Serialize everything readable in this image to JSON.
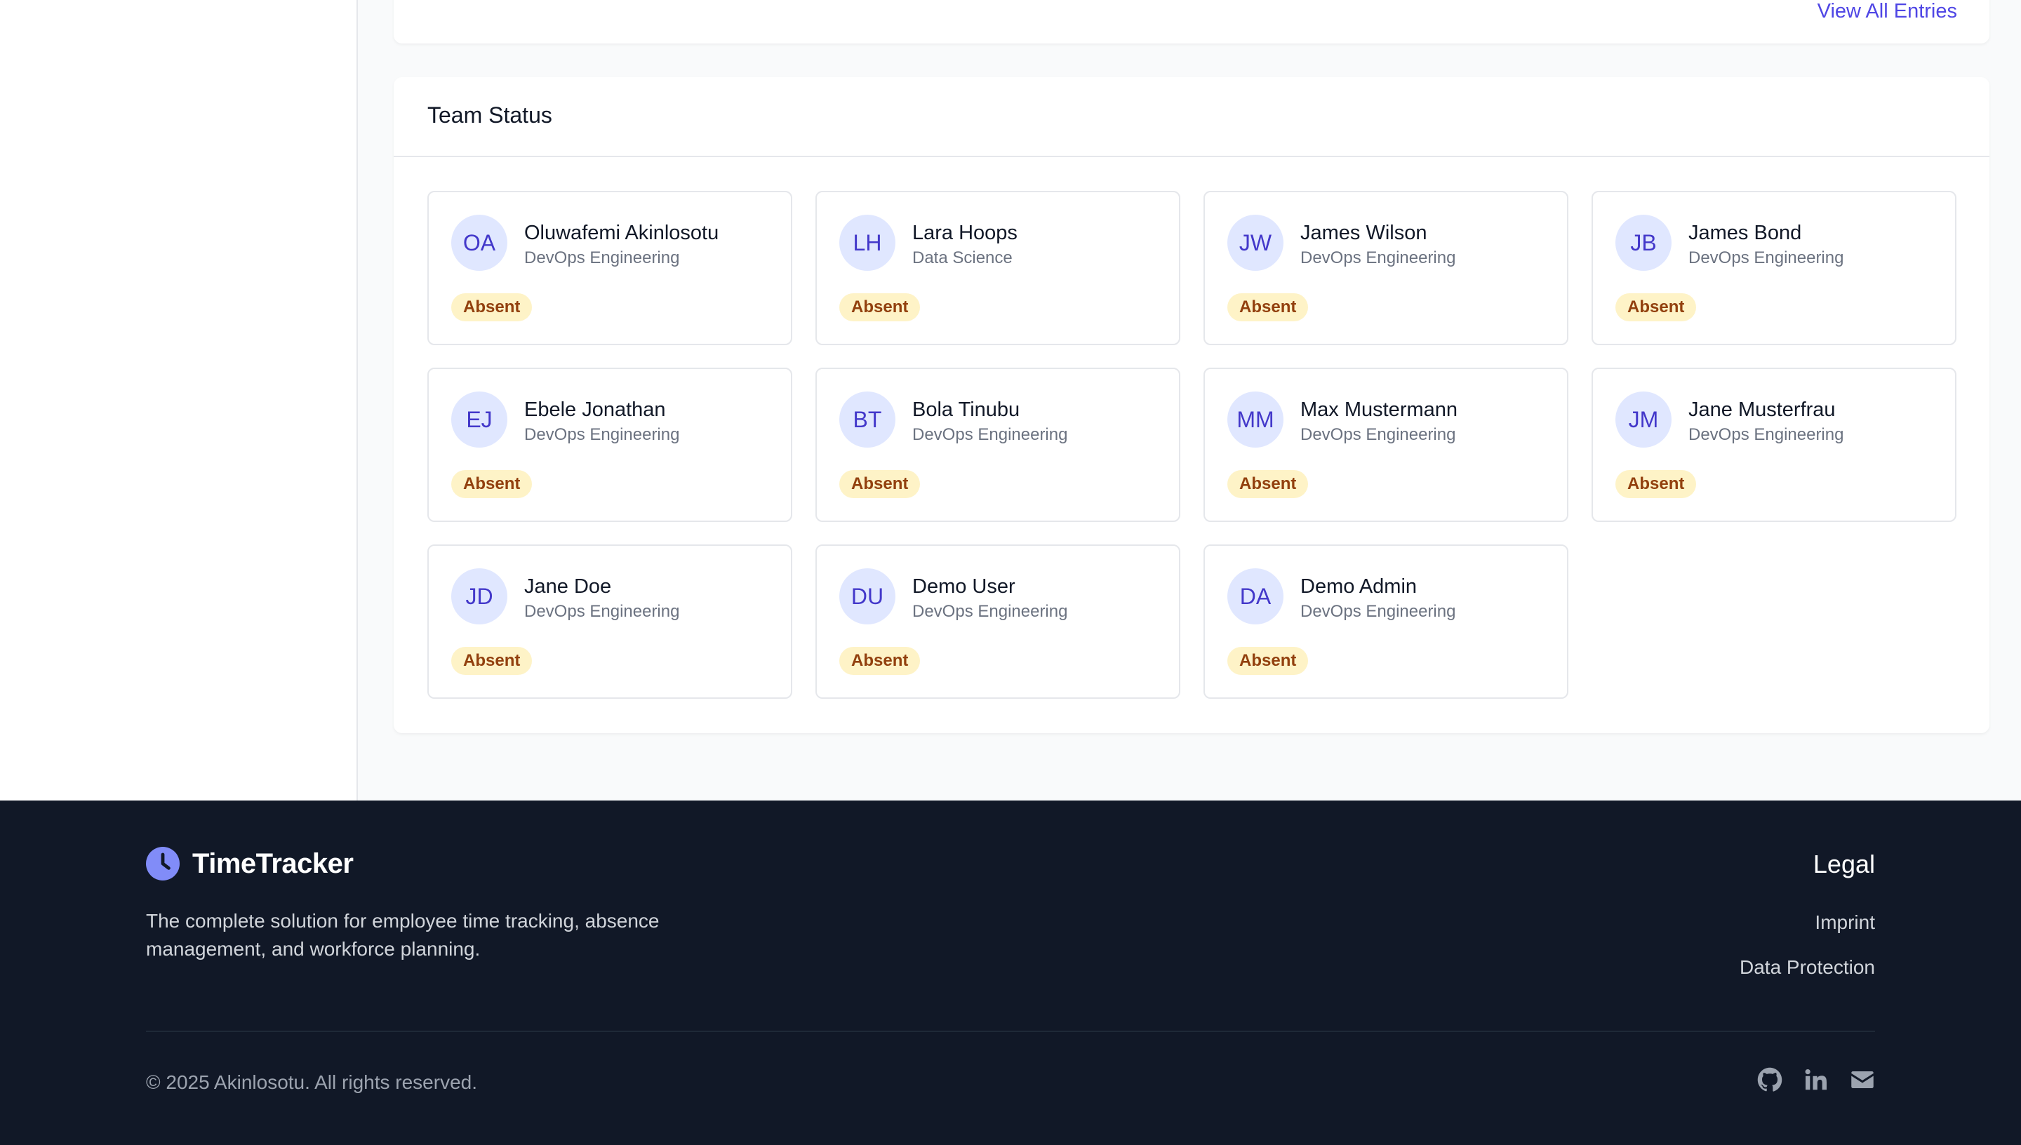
{
  "recent_entries": {
    "view_all_label": "View All Entries"
  },
  "team_status": {
    "title": "Team Status",
    "members": [
      {
        "initials": "OA",
        "name": "Oluwafemi Akinlosotu",
        "department": "DevOps Engineering",
        "status": "Absent"
      },
      {
        "initials": "LH",
        "name": "Lara Hoops",
        "department": "Data Science",
        "status": "Absent"
      },
      {
        "initials": "JW",
        "name": "James Wilson",
        "department": "DevOps Engineering",
        "status": "Absent"
      },
      {
        "initials": "JB",
        "name": "James Bond",
        "department": "DevOps Engineering",
        "status": "Absent"
      },
      {
        "initials": "EJ",
        "name": "Ebele Jonathan",
        "department": "DevOps Engineering",
        "status": "Absent"
      },
      {
        "initials": "BT",
        "name": "Bola Tinubu",
        "department": "DevOps Engineering",
        "status": "Absent"
      },
      {
        "initials": "MM",
        "name": "Max Mustermann",
        "department": "DevOps Engineering",
        "status": "Absent"
      },
      {
        "initials": "JM",
        "name": "Jane Musterfrau",
        "department": "DevOps Engineering",
        "status": "Absent"
      },
      {
        "initials": "JD",
        "name": "Jane Doe",
        "department": "DevOps Engineering",
        "status": "Absent"
      },
      {
        "initials": "DU",
        "name": "Demo User",
        "department": "DevOps Engineering",
        "status": "Absent"
      },
      {
        "initials": "DA",
        "name": "Demo Admin",
        "department": "DevOps Engineering",
        "status": "Absent"
      }
    ]
  },
  "footer": {
    "brand_name": "TimeTracker",
    "brand_icon": "clock-icon",
    "tagline": "The complete solution for employee time tracking, absence management, and workforce planning.",
    "legal_title": "Legal",
    "legal_links": [
      "Imprint",
      "Data Protection"
    ],
    "copyright": "© 2025 Akinlosotu. All rights reserved.",
    "social_icons": [
      "github-icon",
      "linkedin-icon",
      "email-icon"
    ]
  },
  "colors": {
    "accent": "#4f46e5",
    "avatar_bg": "#e0e7ff",
    "badge_bg": "#fef3c7",
    "badge_text": "#92400e",
    "footer_bg": "#111827",
    "brand_icon": "#818cf8"
  }
}
